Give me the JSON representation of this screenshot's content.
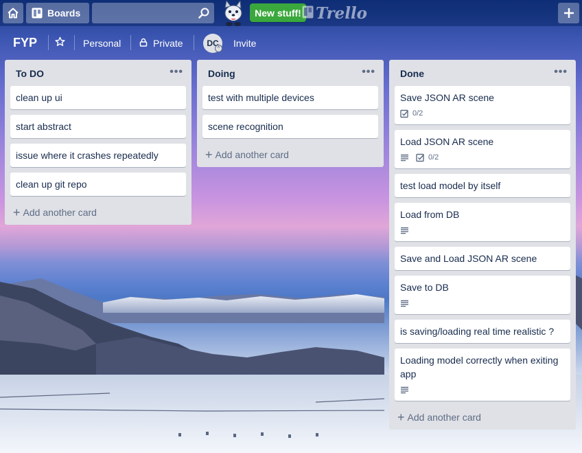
{
  "topbar": {
    "home_icon": "home-icon",
    "boards_label": "Boards",
    "search_value": "",
    "search_placeholder": "",
    "new_stuff_label": "New stuff!",
    "logo_text": "Trello",
    "create_icon": "plus-icon"
  },
  "board": {
    "title": "FYP",
    "team_label": "Personal",
    "visibility_label": "Private",
    "member_initials": "DC",
    "invite_label": "Invite"
  },
  "lists": [
    {
      "title": "To DO",
      "menu": "•••",
      "add_card_label": "Add another card",
      "cards": [
        {
          "title": "clean up ui"
        },
        {
          "title": "start abstract"
        },
        {
          "title": "issue where it crashes repeatedly"
        },
        {
          "title": "clean up git repo"
        }
      ]
    },
    {
      "title": "Doing",
      "menu": "•••",
      "add_card_label": "Add another card",
      "cards": [
        {
          "title": "test with multiple devices"
        },
        {
          "title": "scene recognition"
        }
      ]
    },
    {
      "title": "Done",
      "menu": "•••",
      "add_card_label": "Add another card",
      "cards": [
        {
          "title": "Save JSON AR scene",
          "checklist": "0/2"
        },
        {
          "title": "Load JSON AR scene",
          "description": true,
          "checklist": "0/2"
        },
        {
          "title": "test load model by itself"
        },
        {
          "title": "Load from DB",
          "description": true
        },
        {
          "title": "Save and Load JSON AR scene"
        },
        {
          "title": "Save to DB",
          "description": true
        },
        {
          "title": "is saving/loading real time realistic ?"
        },
        {
          "title": "Loading model correctly when exiting app",
          "description": true
        }
      ]
    }
  ]
}
